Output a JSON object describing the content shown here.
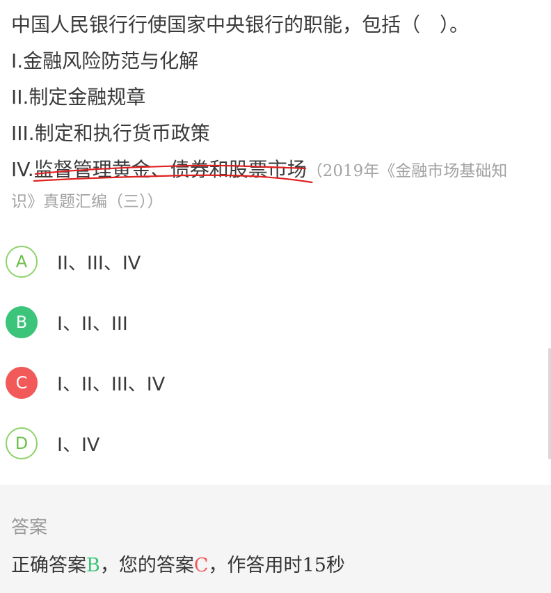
{
  "question": {
    "stem": "中国人民银行行使国家中央银行的职能，包括（　）。",
    "items": [
      {
        "prefix": "I.",
        "text": "金融风险防范与化解"
      },
      {
        "prefix": "II.",
        "text": "制定金融规章"
      },
      {
        "prefix": "III.",
        "text": "制定和执行货币政策"
      },
      {
        "prefix": "IV.",
        "text": "监督管理黄金、债券和股票市场"
      }
    ],
    "source_part1": "（2019年《金融市场基础知",
    "source_part2": "识》真题汇编（三））"
  },
  "options": [
    {
      "letter": "A",
      "text": "II、III、IV",
      "state": "default"
    },
    {
      "letter": "B",
      "text": "I、II、III",
      "state": "correct"
    },
    {
      "letter": "C",
      "text": "I、II、III、IV",
      "state": "wrong"
    },
    {
      "letter": "D",
      "text": "I、IV",
      "state": "default"
    }
  ],
  "answer": {
    "title": "答案",
    "correct_label": "正确答案",
    "correct_value": "B",
    "sep1": "，",
    "your_label": "您的答案",
    "your_value": "C",
    "sep2": "，",
    "time_label": "作答用时",
    "time_value": "15秒"
  },
  "colors": {
    "correct": "#3cc47a",
    "wrong": "#f25a5a",
    "outline": "#8fd36d",
    "annotation_ink": "#e02020",
    "panel_bg": "#f5f5f5"
  }
}
